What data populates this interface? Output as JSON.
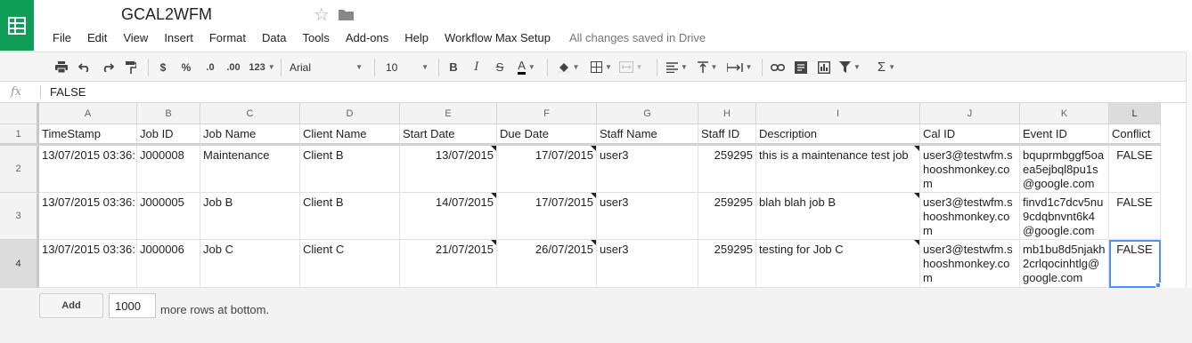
{
  "app": {
    "title": "GCAL2WFM",
    "menus": [
      "File",
      "Edit",
      "View",
      "Insert",
      "Format",
      "Data",
      "Tools",
      "Add-ons",
      "Help",
      "Workflow Max Setup"
    ],
    "save_status": "All changes saved in Drive",
    "brand_color": "#0f9d58"
  },
  "toolbar": {
    "currency_label": "$",
    "percent_label": "%",
    "decrease_decimals_label": ".0",
    "increase_decimals_label": ".00",
    "more_formats_label": "123",
    "font_name": "Arial",
    "font_size": "10",
    "bold_label": "B",
    "italic_label": "I",
    "strike_label": "S",
    "text_color_label": "A",
    "sum_label": "Σ"
  },
  "formula_bar": {
    "fx_label": "fx",
    "value": "FALSE"
  },
  "sheet": {
    "column_letters": [
      "A",
      "B",
      "C",
      "D",
      "E",
      "F",
      "G",
      "H",
      "I",
      "J",
      "K",
      "L"
    ],
    "row_numbers": [
      "1",
      "2",
      "3",
      "4"
    ],
    "headers": [
      "TimeStamp",
      "Job ID",
      "Job Name",
      "Client Name",
      "Start Date",
      "Due Date",
      "Staff Name",
      "Staff ID",
      "Description",
      "Cal ID",
      "Event ID",
      "Conflict"
    ],
    "rows": [
      [
        "13/07/2015 03:36:",
        "J000008",
        "Maintenance",
        "Client B",
        "13/07/2015",
        "17/07/2015",
        "user3",
        "259295",
        "this is a maintenance test job",
        "user3@testwfm.shooshmonkey.com",
        "bquprmbggf5oaea5ejbql8pu1s@google.com",
        "FALSE"
      ],
      [
        "13/07/2015 03:36:",
        "J000005",
        "Job B",
        "Client B",
        "14/07/2015",
        "17/07/2015",
        "user3",
        "259295",
        "blah blah job B",
        "user3@testwfm.shooshmonkey.com",
        "finvd1c7dcv5nu9cdqbnvnt6k4@google.com",
        "FALSE"
      ],
      [
        "13/07/2015 03:36:",
        "J000006",
        "Job C",
        "Client C",
        "21/07/2015",
        "26/07/2015",
        "user3",
        "259295",
        "testing for Job C",
        "user3@testwfm.shooshmonkey.com",
        "mb1bu8d5njakh2crlqocinhtlg@google.com",
        "FALSE"
      ]
    ],
    "active_cell": "L4",
    "selection_color": "#4d90fe"
  },
  "footer": {
    "add_label": "Add",
    "rows_value": "1000",
    "more_rows_label": "more rows at bottom."
  }
}
